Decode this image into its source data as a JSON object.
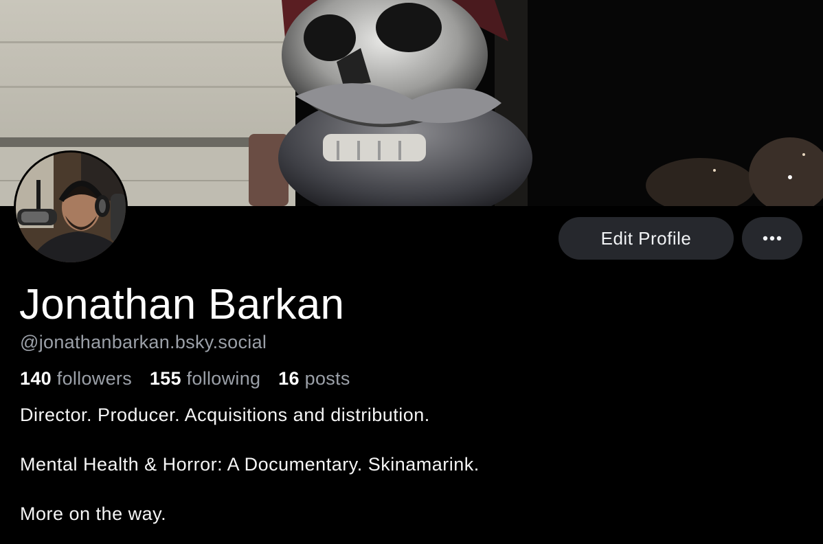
{
  "profile": {
    "display_name": "Jonathan Barkan",
    "handle": "@jonathanbarkan.bsky.social",
    "stats": {
      "followers_count": "140",
      "followers_label": "followers",
      "following_count": "155",
      "following_label": "following",
      "posts_count": "16",
      "posts_label": "posts"
    },
    "bio": [
      "Director. Producer. Acquisitions and distribution.",
      "Mental Health & Horror: A Documentary. Skinamarink.",
      "More on the way."
    ]
  },
  "actions": {
    "edit_profile_label": "Edit Profile",
    "more_icon": "ellipsis-icon"
  },
  "colors": {
    "background": "#000000",
    "button_bg": "#26282d",
    "muted_text": "#9ba0a8"
  }
}
